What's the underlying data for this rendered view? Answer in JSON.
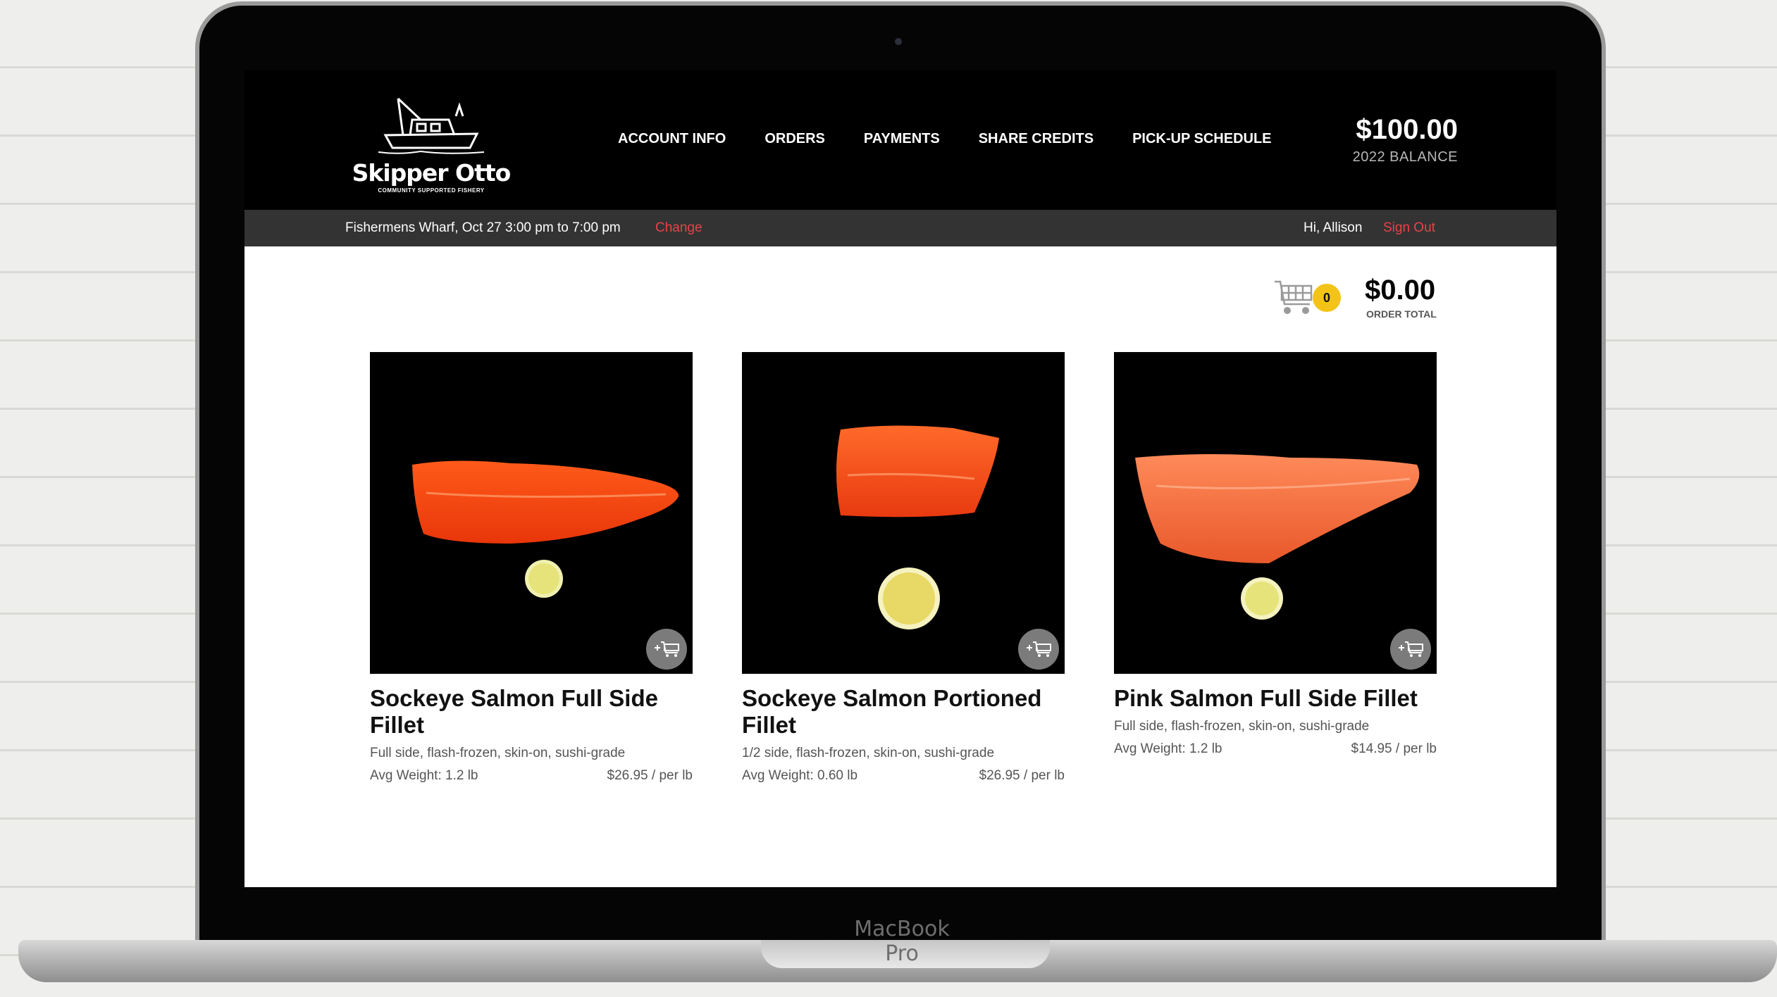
{
  "device": {
    "label": "MacBook Pro"
  },
  "brand": {
    "name": "Skipper Otto",
    "tagline": "COMMUNITY SUPPORTED FISHERY"
  },
  "nav": {
    "items": [
      {
        "label": "ACCOUNT INFO"
      },
      {
        "label": "ORDERS"
      },
      {
        "label": "PAYMENTS"
      },
      {
        "label": "SHARE CREDITS"
      },
      {
        "label": "PICK-UP SCHEDULE"
      }
    ]
  },
  "balance": {
    "amount": "$100.00",
    "label": "2022 BALANCE"
  },
  "infobar": {
    "pickup": "Fishermens Wharf, Oct 27 3:00 pm to 7:00 pm",
    "change_label": "Change",
    "greeting": "Hi, Allison",
    "signout_label": "Sign Out"
  },
  "cart": {
    "count": "0",
    "total": "$0.00",
    "total_label": "ORDER TOTAL"
  },
  "products": [
    {
      "title": "Sockeye Salmon Full Side Fillet",
      "description": "Full side, flash-frozen, skin-on, sushi-grade",
      "avg_weight": "Avg Weight: 1.2 lb",
      "price": "$26.95 / per lb",
      "image_icon": "sockeye-full-side-image"
    },
    {
      "title": "Sockeye Salmon Portioned Fillet",
      "description": "1/2 side, flash-frozen, skin-on, sushi-grade",
      "avg_weight": "Avg Weight: 0.60 lb",
      "price": "$26.95 / per lb",
      "image_icon": "sockeye-portioned-image"
    },
    {
      "title": "Pink Salmon Full Side Fillet",
      "description": "Full side, flash-frozen, skin-on, sushi-grade",
      "avg_weight": "Avg Weight: 1.2 lb",
      "price": "$14.95 / per lb",
      "image_icon": "pink-full-side-image"
    }
  ],
  "colors": {
    "accent": "#e8424a",
    "cart_badge": "#f3c417",
    "topbar": "#000000",
    "infobar": "#333333"
  }
}
